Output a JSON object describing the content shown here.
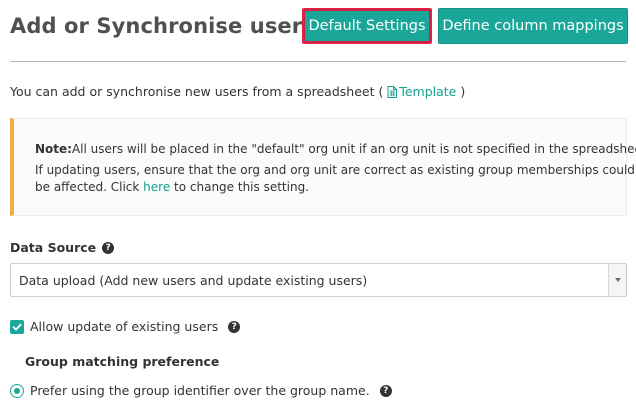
{
  "header": {
    "title": "Add or Synchronise users f...",
    "default_settings_label": "Default Settings",
    "define_mappings_label": "Define column mappings"
  },
  "intro": {
    "text": "You can add or synchronise new users from a spreadsheet (",
    "template_label": "Template",
    "suffix": ")"
  },
  "note": {
    "label": "Note:",
    "line1": "All users will be placed in the \"default\" org unit if an org unit is not specified in the spreadsheet.",
    "line2": "If updating users, ensure that the org and org unit are correct as existing group memberships could",
    "line3_pre": "be affected. Click ",
    "line3_link": "here",
    "line3_post": " to change this setting.",
    "accent_color": "#f2ae3f"
  },
  "data_source": {
    "label": "Data Source",
    "selected": "Data upload (Add new users and update existing users)"
  },
  "options": {
    "allow_update_label": "Allow update of existing users",
    "allow_update_checked": true,
    "group_matching_title": "Group matching preference",
    "group_matching_option": "Prefer using the group identifier over the group name.",
    "group_matching_selected": true
  },
  "theme": {
    "accent": "#1aa79a",
    "highlight_border": "#e0224a"
  },
  "icons": {
    "help": "help-circle-icon",
    "template": "spreadsheet-file-icon",
    "checkbox": "check-icon",
    "dropdown": "chevron-down-icon"
  }
}
